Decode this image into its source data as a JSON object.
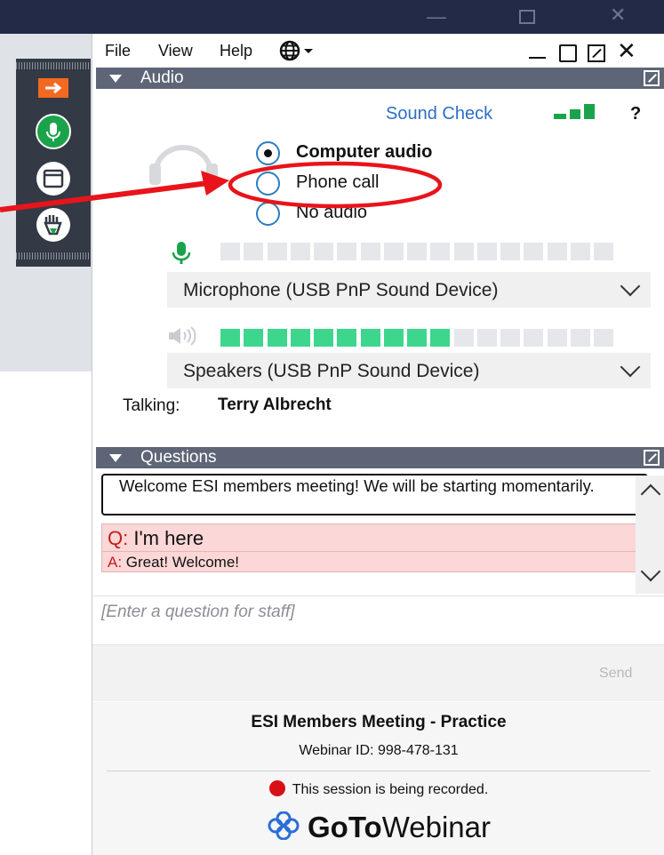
{
  "window": {
    "menu": [
      "File",
      "View",
      "Help"
    ],
    "controls": [
      "_",
      "□",
      "⧅",
      "✕"
    ]
  },
  "audio": {
    "section_title": "Audio",
    "sound_check": "Sound Check",
    "help_glyph": "?",
    "options": [
      "Computer audio",
      "Phone call",
      "No audio"
    ],
    "selected_option": "Computer audio",
    "highlighted_option": "Phone call",
    "mic_level_fraction": 0.0,
    "microphone_device": "Microphone (USB PnP Sound Device)",
    "speaker_level_fraction": 0.6,
    "speaker_device": "Speakers (USB PnP Sound Device)",
    "talking_label": "Talking:",
    "talking_name": "Terry Albrecht"
  },
  "questions": {
    "section_title": "Questions",
    "welcome_message": "Welcome ESI members meeting!  We will be starting momentarily.",
    "q_prefix": "Q:",
    "q_text": "I'm here",
    "a_prefix": "A:",
    "a_text": "Great! Welcome!",
    "input_placeholder": "[Enter a question for staff]",
    "send_label": "Send"
  },
  "footer": {
    "meeting_title": "ESI Members Meeting - Practice",
    "webinar_id": "Webinar ID: 998-478-131",
    "recording_notice": "This session is being recorded.",
    "brand_bold": "GoTo",
    "brand_light": "Webinar"
  },
  "colors": {
    "accent_blue": "#2c6fc4",
    "meter_green": "#3dd68c",
    "mic_green": "#1aa34a",
    "header_gray": "#5d6576",
    "annotation_red": "#e8141b",
    "record_red": "#d90f17",
    "question_pink": "#fbd7d7"
  }
}
